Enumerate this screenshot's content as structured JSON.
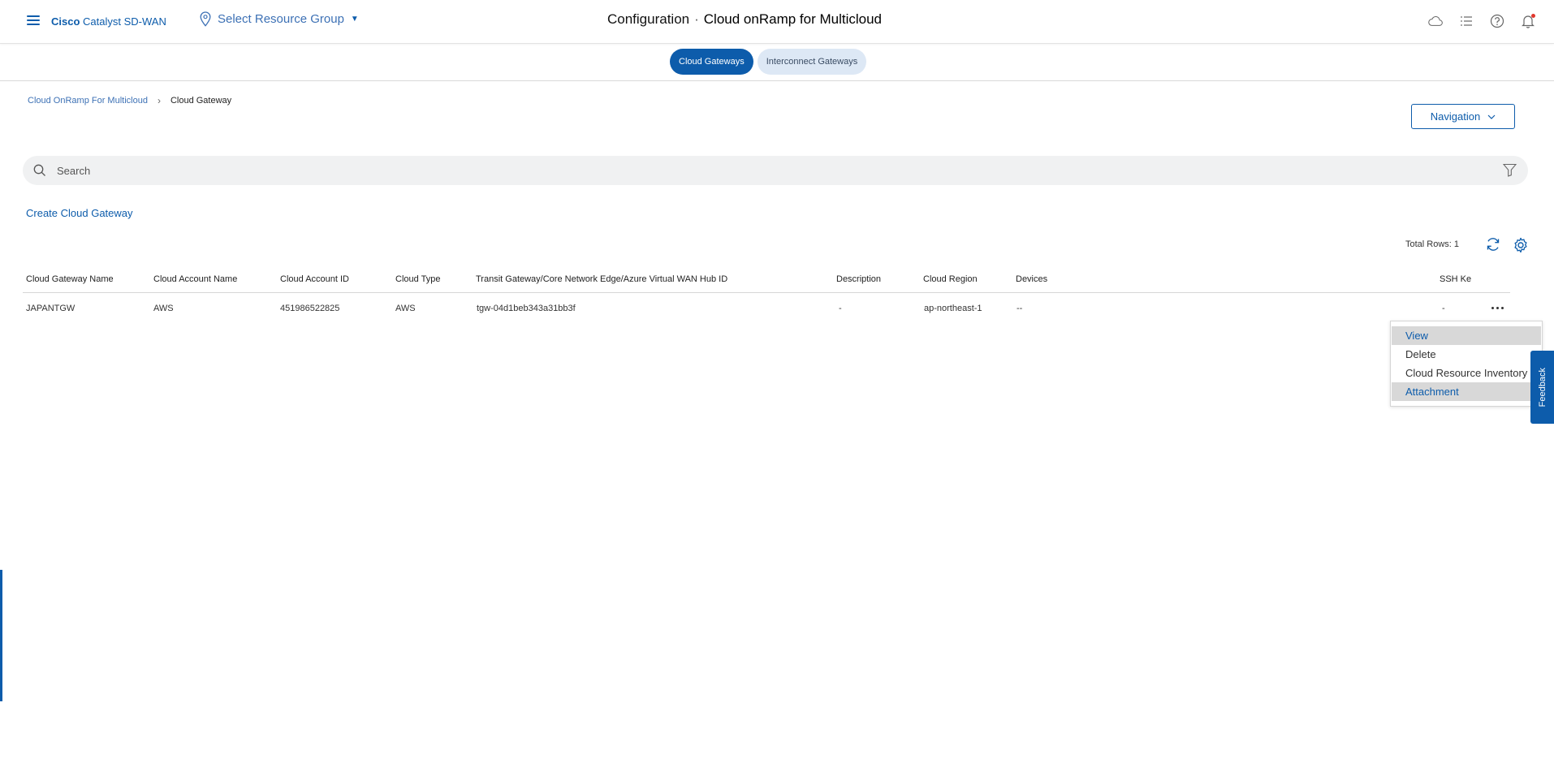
{
  "header": {
    "brand_bold": "Cisco",
    "brand_rest": "Catalyst SD-WAN",
    "resource_group": "Select Resource Group",
    "title_section": "Configuration",
    "title_separator": "·",
    "title_page": "Cloud onRamp for Multicloud",
    "icons": [
      "cloud-icon",
      "list-icon",
      "help-icon",
      "bell-icon"
    ]
  },
  "tabs": [
    {
      "label": "Cloud Gateways",
      "active": true
    },
    {
      "label": "Interconnect Gateways",
      "active": false
    }
  ],
  "breadcrumb": {
    "parent": "Cloud OnRamp For Multicloud",
    "current": "Cloud Gateway"
  },
  "navigation_button": "Navigation",
  "search": {
    "placeholder": "Search"
  },
  "create_link": "Create Cloud Gateway",
  "total_rows": "Total Rows: 1",
  "table": {
    "columns": [
      "Cloud Gateway Name",
      "Cloud Account Name",
      "Cloud Account ID",
      "Cloud Type",
      "Transit Gateway/Core Network Edge/Azure Virtual WAN Hub ID",
      "Description",
      "Cloud Region",
      "Devices",
      "SSH Ke"
    ],
    "rows": [
      [
        "JAPANTGW",
        "AWS",
        "451986522825",
        "AWS",
        "tgw-04d1beb343a31bb3f",
        "-",
        "ap-northeast-1",
        "--",
        "-"
      ]
    ]
  },
  "row_menu": {
    "items": [
      "View",
      "Delete",
      "Cloud Resource Inventory",
      "Attachment"
    ]
  },
  "feedback_label": "Feedback",
  "colors": {
    "accent": "#0d5cab",
    "link": "#3d71b5",
    "tab_inactive_bg": "#dde8f5"
  }
}
